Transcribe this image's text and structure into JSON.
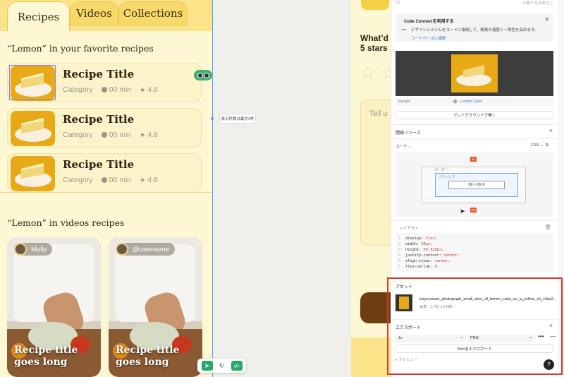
{
  "tabs": [
    {
      "label": "Recipes"
    },
    {
      "label": "Videos"
    },
    {
      "label": "Collections"
    }
  ],
  "favorites": {
    "title": "“Lemon” in your favorite recipes",
    "items": [
      {
        "name": "Recipe Title",
        "category": "Category",
        "time": "00 min",
        "rating": "4.8"
      },
      {
        "name": "Recipe Title",
        "category": "Category",
        "time": "00 min",
        "rating": "4.8"
      },
      {
        "name": "Recipe Title",
        "category": "Category",
        "time": "00 min",
        "rating": "4.8"
      }
    ]
  },
  "videos": {
    "title": "“Lemon” in videos recipes",
    "items": [
      {
        "user": "Molly",
        "title": "Recipe title goes long"
      },
      {
        "user": "@username",
        "title": "Recipe title goes long"
      }
    ]
  },
  "canvas_note": "表示件数は最大3件",
  "right_frame": {
    "question_line1": "What’d",
    "question_line2": "5 stars",
    "tell_placeholder": "Tell u"
  },
  "panel": {
    "top_text": "公開する変更なし",
    "code_connect": {
      "title": "Code Connectを利用する",
      "description": "デザインシステムをコードに接続して、開発の速度と一貫性を高めます。",
      "link": "コードベースに接続"
    },
    "recipe_prop": {
      "key": "Recipe",
      "value": "Lemon Cake"
    },
    "playground_button": "プレイグラウンドで開く",
    "dev_resources": "開発リソース",
    "code_select": "コード",
    "css_select": "CSS",
    "box_model": {
      "border_label": "ボーダー",
      "padding_label": "パディング",
      "size": "69 × 69.9",
      "top_marker": "9",
      "bottom_marker": "0.9",
      "dash": "-"
    },
    "layout_label": "レイアウト",
    "code_lines": [
      {
        "num": "1",
        "prop": "display: ",
        "val": "flex;"
      },
      {
        "num": "2",
        "prop": "width: ",
        "val": "69px;"
      },
      {
        "num": "3",
        "prop": "height: ",
        "val": "69.929px;"
      },
      {
        "num": "4",
        "prop": "justify-content: ",
        "val": "center;"
      },
      {
        "num": "5",
        "prop": "align-items: ",
        "val": "center;"
      },
      {
        "num": "6",
        "prop": "flex-shrink: ",
        "val": "0;"
      }
    ],
    "assets_title": "アセット",
    "asset_name": "taryncowart_photograph_small_slice_of_lemon_cake_on_a_yellow_ch_c4ac2...",
    "asset_size": "画像 · 1,792 x 2,688",
    "export_title": "エクスポート",
    "export_scale": "1x",
    "export_format": "PNG",
    "export_button": "Dishをエクスポート",
    "preview_label": "プレビュー",
    "help": "?"
  }
}
